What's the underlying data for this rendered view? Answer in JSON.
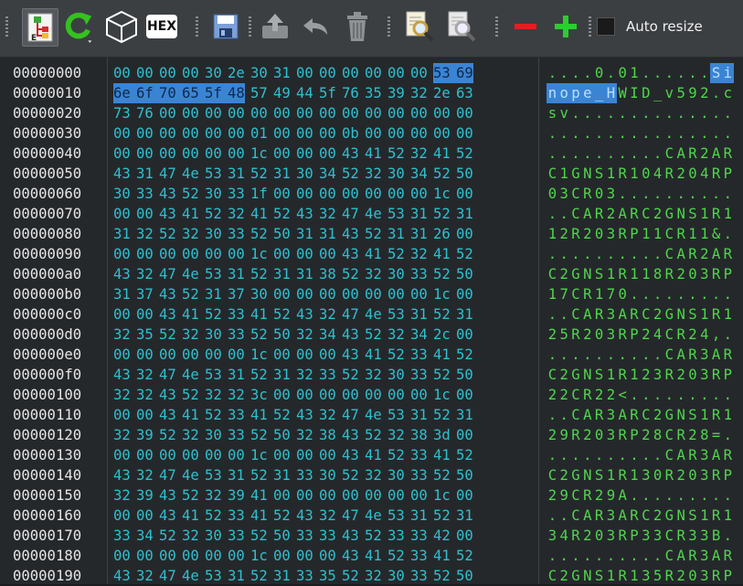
{
  "toolbar": {
    "auto_resize_label": "Auto resize",
    "hex_label": "HEX",
    "icons": [
      "tree-structure-icon",
      "refresh-icon",
      "cube-icon",
      "hex-icon",
      "save-icon",
      "upload-icon",
      "undo-icon",
      "trash-icon",
      "find-icon",
      "find-next-icon",
      "remove-icon",
      "add-icon"
    ]
  },
  "hex_view": {
    "selection": {
      "start": 14,
      "end": 21
    },
    "rows": [
      {
        "offset": "00000000",
        "hex": "00 00 00 00 30 2e 30 31 00 00 00 00 00 00 53 69",
        "ascii": "....0.01......Si"
      },
      {
        "offset": "00000010",
        "hex": "6e 6f 70 65 5f 48 57 49 44 5f 76 35 39 32 2e 63",
        "ascii": "nope_HWID_v592.c"
      },
      {
        "offset": "00000020",
        "hex": "73 76 00 00 00 00 00 00 00 00 00 00 00 00 00 00",
        "ascii": "sv.............."
      },
      {
        "offset": "00000030",
        "hex": "00 00 00 00 00 00 01 00 00 00 0b 00 00 00 00 00",
        "ascii": "................"
      },
      {
        "offset": "00000040",
        "hex": "00 00 00 00 00 00 1c 00 00 00 43 41 52 32 41 52",
        "ascii": "..........CAR2AR"
      },
      {
        "offset": "00000050",
        "hex": "43 31 47 4e 53 31 52 31 30 34 52 32 30 34 52 50",
        "ascii": "C1GNS1R104R204RP"
      },
      {
        "offset": "00000060",
        "hex": "30 33 43 52 30 33 1f 00 00 00 00 00 00 00 1c 00",
        "ascii": "03CR03.........."
      },
      {
        "offset": "00000070",
        "hex": "00 00 43 41 52 32 41 52 43 32 47 4e 53 31 52 31",
        "ascii": "..CAR2ARC2GNS1R1"
      },
      {
        "offset": "00000080",
        "hex": "31 32 52 32 30 33 52 50 31 31 43 52 31 31 26 00",
        "ascii": "12R203RP11CR11&."
      },
      {
        "offset": "00000090",
        "hex": "00 00 00 00 00 00 1c 00 00 00 43 41 52 32 41 52",
        "ascii": "..........CAR2AR"
      },
      {
        "offset": "000000a0",
        "hex": "43 32 47 4e 53 31 52 31 31 38 52 32 30 33 52 50",
        "ascii": "C2GNS1R118R203RP"
      },
      {
        "offset": "000000b0",
        "hex": "31 37 43 52 31 37 30 00 00 00 00 00 00 00 1c 00",
        "ascii": "17CR170........."
      },
      {
        "offset": "000000c0",
        "hex": "00 00 43 41 52 33 41 52 43 32 47 4e 53 31 52 31",
        "ascii": "..CAR3ARC2GNS1R1"
      },
      {
        "offset": "000000d0",
        "hex": "32 35 52 32 30 33 52 50 32 34 43 52 32 34 2c 00",
        "ascii": "25R203RP24CR24,."
      },
      {
        "offset": "000000e0",
        "hex": "00 00 00 00 00 00 1c 00 00 00 43 41 52 33 41 52",
        "ascii": "..........CAR3AR"
      },
      {
        "offset": "000000f0",
        "hex": "43 32 47 4e 53 31 52 31 32 33 52 32 30 33 52 50",
        "ascii": "C2GNS1R123R203RP"
      },
      {
        "offset": "00000100",
        "hex": "32 32 43 52 32 32 3c 00 00 00 00 00 00 00 1c 00",
        "ascii": "22CR22<........."
      },
      {
        "offset": "00000110",
        "hex": "00 00 43 41 52 33 41 52 43 32 47 4e 53 31 52 31",
        "ascii": "..CAR3ARC2GNS1R1"
      },
      {
        "offset": "00000120",
        "hex": "32 39 52 32 30 33 52 50 32 38 43 52 32 38 3d 00",
        "ascii": "29R203RP28CR28=."
      },
      {
        "offset": "00000130",
        "hex": "00 00 00 00 00 00 1c 00 00 00 43 41 52 33 41 52",
        "ascii": "..........CAR3AR"
      },
      {
        "offset": "00000140",
        "hex": "43 32 47 4e 53 31 52 31 33 30 52 32 30 33 52 50",
        "ascii": "C2GNS1R130R203RP"
      },
      {
        "offset": "00000150",
        "hex": "32 39 43 52 32 39 41 00 00 00 00 00 00 00 1c 00",
        "ascii": "29CR29A........."
      },
      {
        "offset": "00000160",
        "hex": "00 00 43 41 52 33 41 52 43 32 47 4e 53 31 52 31",
        "ascii": "..CAR3ARC2GNS1R1"
      },
      {
        "offset": "00000170",
        "hex": "33 34 52 32 30 33 52 50 33 33 43 52 33 33 42 00",
        "ascii": "34R203RP33CR33B."
      },
      {
        "offset": "00000180",
        "hex": "00 00 00 00 00 00 1c 00 00 00 43 41 52 33 41 52",
        "ascii": "..........CAR3AR"
      },
      {
        "offset": "00000190",
        "hex": "43 32 47 4e 53 31 52 31 33 35 52 32 30 33 52 50",
        "ascii": "C2GNS1R135R203RP"
      }
    ]
  }
}
